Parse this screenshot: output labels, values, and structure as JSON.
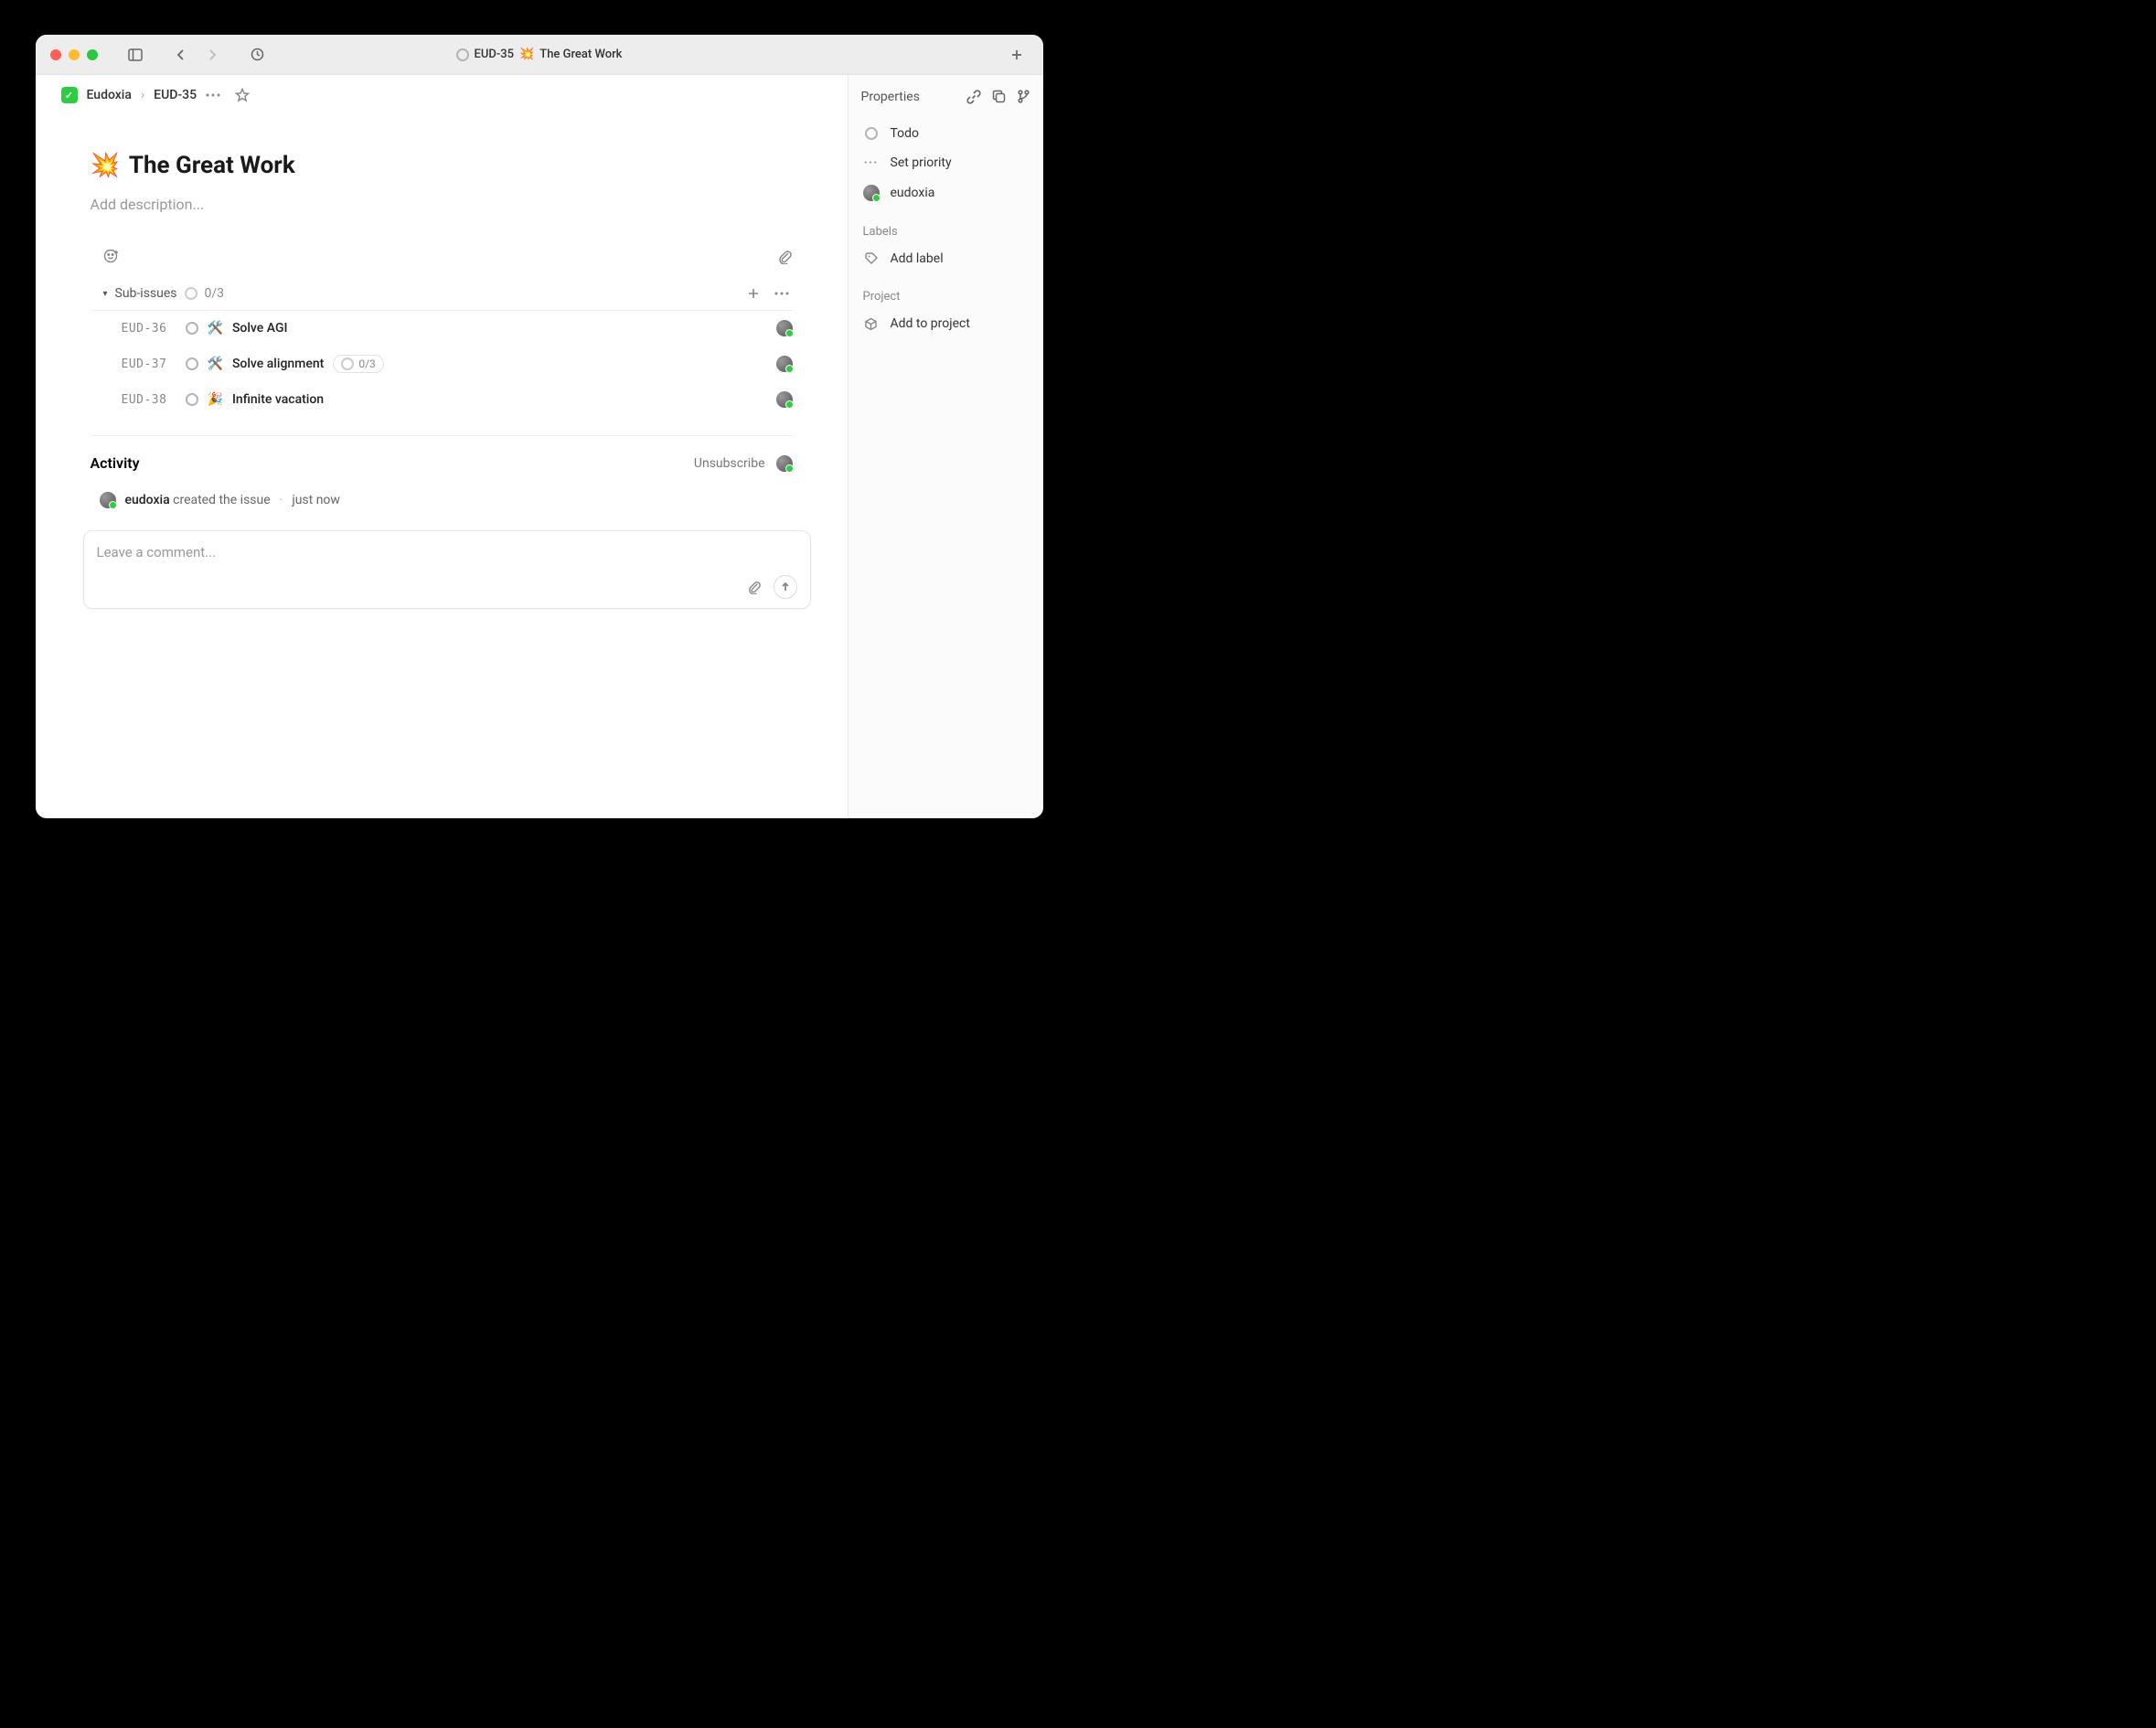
{
  "titlebar": {
    "issue_id": "EUD-35",
    "emoji": "💥",
    "title": "The Great Work"
  },
  "breadcrumb": {
    "project": "Eudoxia",
    "issue_id": "EUD-35"
  },
  "issue": {
    "emoji": "💥",
    "title": "The Great Work",
    "description_placeholder": "Add description..."
  },
  "subissues": {
    "label": "Sub-issues",
    "count": "0/3",
    "items": [
      {
        "id": "EUD-36",
        "emoji": "🛠️",
        "title": "Solve AGI",
        "sub_count": null
      },
      {
        "id": "EUD-37",
        "emoji": "🛠️",
        "title": "Solve alignment",
        "sub_count": "0/3"
      },
      {
        "id": "EUD-38",
        "emoji": "🎉",
        "title": "Infinite vacation",
        "sub_count": null
      }
    ]
  },
  "activity": {
    "heading": "Activity",
    "unsubscribe": "Unsubscribe",
    "items": [
      {
        "user": "eudoxia",
        "action": "created the issue",
        "time": "just now"
      }
    ]
  },
  "comment": {
    "placeholder": "Leave a comment..."
  },
  "sidebar": {
    "properties_label": "Properties",
    "status": "Todo",
    "priority": "Set priority",
    "assignee": "eudoxia",
    "labels_heading": "Labels",
    "add_label": "Add label",
    "project_heading": "Project",
    "add_project": "Add to project"
  }
}
